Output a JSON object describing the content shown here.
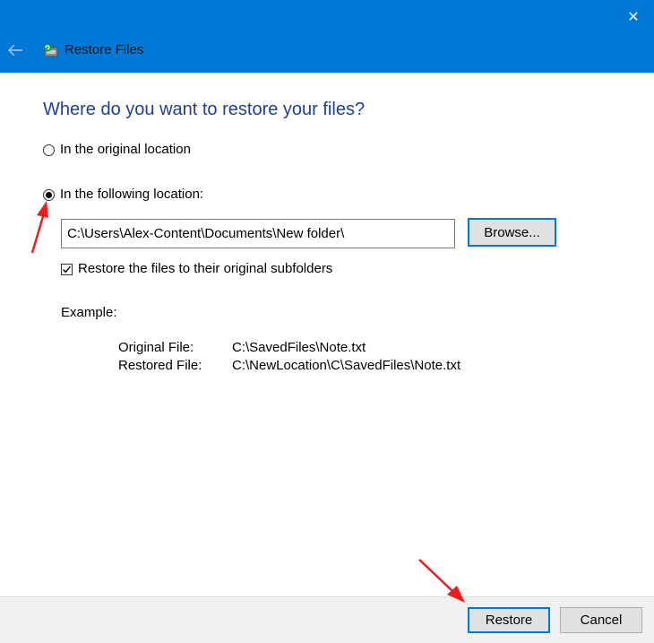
{
  "window": {
    "title": "Restore Files",
    "close_symbol": "✕",
    "icons": [
      "back-arrow-icon",
      "restore-files-app-icon",
      "close-icon"
    ],
    "accent_color": "#0078d7"
  },
  "main": {
    "heading": "Where do you want to restore your files?",
    "options": [
      {
        "label": "In the original location",
        "selected": false
      },
      {
        "label": "In the following location:",
        "selected": true
      }
    ],
    "location": {
      "value": "C:\\Users\\Alex-Content\\Documents\\New folder\\",
      "browse_label": "Browse..."
    },
    "subfolders": {
      "label": "Restore the files to their original subfolders",
      "checked": true
    },
    "example": {
      "label": "Example:",
      "rows": [
        {
          "key": "Original File:",
          "value": "C:\\SavedFiles\\Note.txt"
        },
        {
          "key": "Restored File:",
          "value": "C:\\NewLocation\\C\\SavedFiles\\Note.txt"
        }
      ]
    }
  },
  "footer": {
    "restore_label": "Restore",
    "cancel_label": "Cancel"
  },
  "annotation_color": "#ee1c1c"
}
